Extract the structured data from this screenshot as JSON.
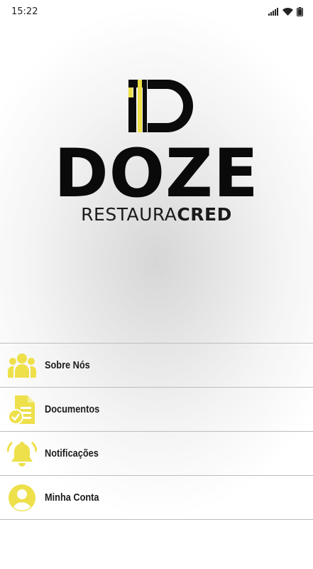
{
  "status_bar": {
    "time": "15:22",
    "icons": [
      "signal-icon",
      "wifi-icon",
      "battery-icon"
    ]
  },
  "brand": {
    "logo_icon": "dz-logo-icon",
    "title": "DOZE",
    "subtitle_light": "RESTAURA",
    "subtitle_bold": "CRED"
  },
  "colors": {
    "accent": "#ede04a",
    "text": "#1b1b1b",
    "divider": "#bdbdbd"
  },
  "menu": {
    "items": [
      {
        "label": "Sobre Nós",
        "icon": "users-icon"
      },
      {
        "label": "Documentos",
        "icon": "document-check-icon"
      },
      {
        "label": "Notificações",
        "icon": "bell-icon"
      },
      {
        "label": "Minha Conta",
        "icon": "user-circle-icon"
      }
    ]
  }
}
